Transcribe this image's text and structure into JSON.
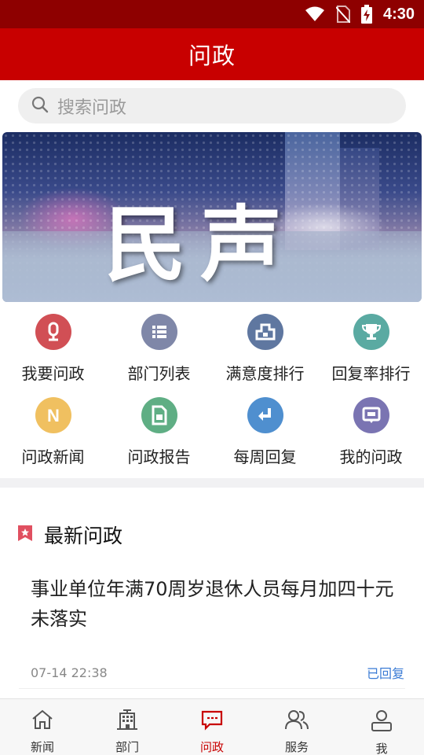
{
  "status_bar": {
    "time": "4:30",
    "icons": [
      "wifi-icon",
      "no-sim-icon",
      "battery-charging-icon"
    ]
  },
  "app_bar": {
    "title": "问政"
  },
  "search": {
    "placeholder": "搜索问政",
    "icon": "search-icon"
  },
  "banner": {
    "text": "民声"
  },
  "grid": [
    {
      "label": "我要问政",
      "icon": "microphone-icon",
      "color": "#d14f55"
    },
    {
      "label": "部门列表",
      "icon": "list-icon",
      "color": "#7f87a8"
    },
    {
      "label": "满意度排行",
      "icon": "ranking-icon",
      "color": "#5f77a0"
    },
    {
      "label": "回复率排行",
      "icon": "trophy-icon",
      "color": "#5aaaa2"
    },
    {
      "label": "问政新闻",
      "icon": "news-n-icon",
      "color": "#f0c060"
    },
    {
      "label": "问政报告",
      "icon": "report-icon",
      "color": "#5fae84"
    },
    {
      "label": "每周回复",
      "icon": "reply-icon",
      "color": "#4f8fcf"
    },
    {
      "label": "我的问政",
      "icon": "chat-screen-icon",
      "color": "#7a74b2"
    }
  ],
  "section": {
    "title": "最新问政",
    "icon": "bookmark-star-icon",
    "accent": "#e05060"
  },
  "news": [
    {
      "headline": "事业单位年满70周岁退休人员每月加四十元未落实",
      "date": "07-14 22:38",
      "status": "已回复"
    }
  ],
  "tabs": [
    {
      "label": "新闻",
      "icon": "home-icon",
      "active": false
    },
    {
      "label": "部门",
      "icon": "building-icon",
      "active": false
    },
    {
      "label": "问政",
      "icon": "message-icon",
      "active": true
    },
    {
      "label": "服务",
      "icon": "people-icon",
      "active": false
    },
    {
      "label": "我",
      "icon": "user-icon",
      "active": false
    }
  ],
  "colors": {
    "primary": "#c80000",
    "status_bar": "#8e0000",
    "link": "#3a7bd5"
  }
}
